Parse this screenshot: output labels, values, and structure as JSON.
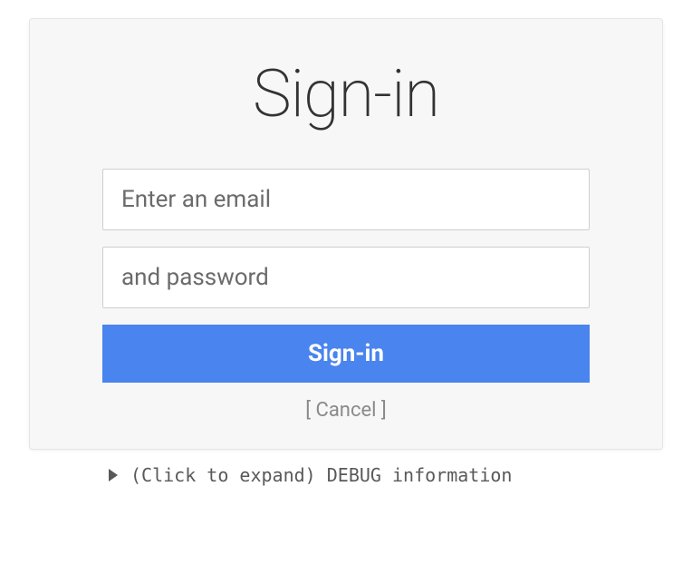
{
  "form": {
    "title": "Sign-in",
    "email": {
      "placeholder": "Enter an email",
      "value": ""
    },
    "password": {
      "placeholder": "and password",
      "value": ""
    },
    "submit_label": "Sign-in",
    "cancel_label": "[ Cancel ]"
  },
  "debug": {
    "label": "(Click to expand) DEBUG information"
  }
}
